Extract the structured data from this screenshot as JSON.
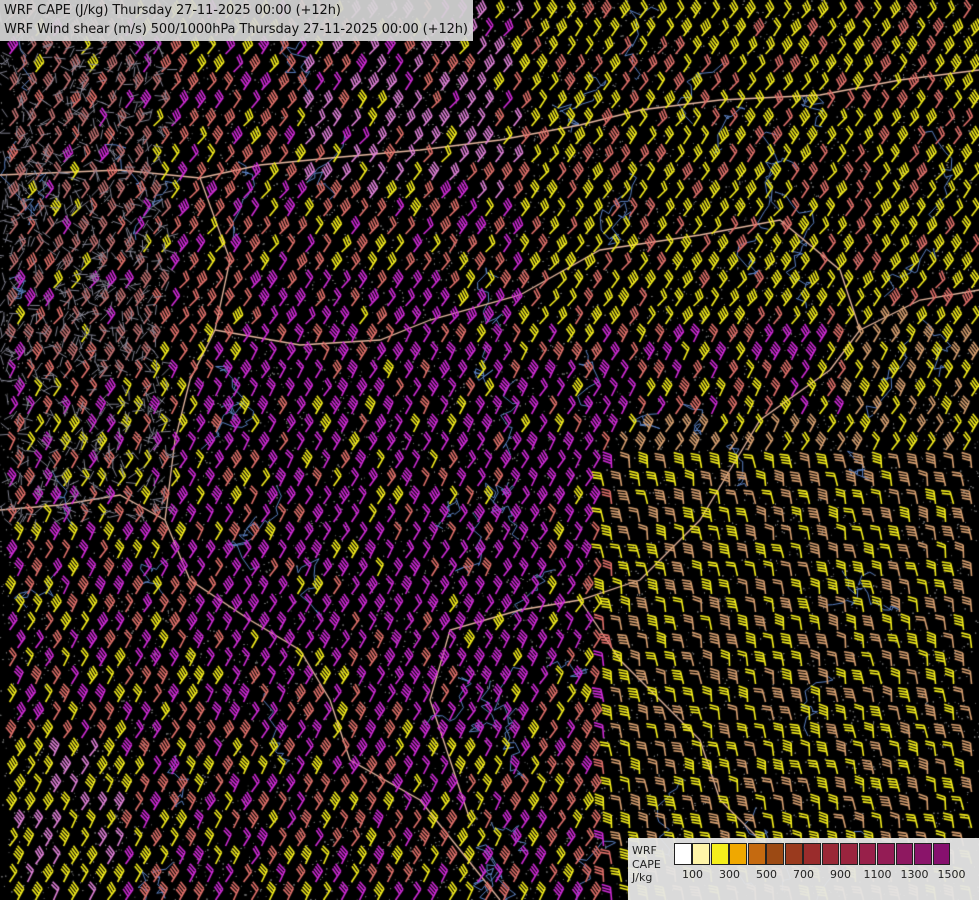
{
  "header": {
    "title_line_1": "WRF CAPE (J/kg) Thursday 27-11-2025 00:00 (+12h)",
    "title_line_2": "WRF Wind shear (m/s) 500/1000hPa Thursday 27-11-2025 00:00 (+12h)"
  },
  "legend": {
    "label_lines": [
      "WRF",
      "CAPE",
      "J/kg"
    ],
    "swatch_colors": [
      "#ffffff",
      "#fff5a8",
      "#f5ee1c",
      "#f0a800",
      "#c56a10",
      "#9c4a14",
      "#9a3a1e",
      "#9a2c2c",
      "#9a2836",
      "#9a243e",
      "#98204a",
      "#941c55",
      "#8e1860",
      "#8a146a",
      "#86106e"
    ],
    "tick_labels": [
      "100",
      "300",
      "500",
      "700",
      "900",
      "1100",
      "1300",
      "1500"
    ]
  },
  "map": {
    "background_color": "#000000",
    "stipple_color": "#6a6a6a",
    "border_color": "#e8b8a0",
    "river_color": "#5a7fc0",
    "barb_colors": [
      "#f5ee1c",
      "#e0706a",
      "#e080d8",
      "#cf2ad6",
      "#d8a070",
      "#c07070"
    ]
  }
}
